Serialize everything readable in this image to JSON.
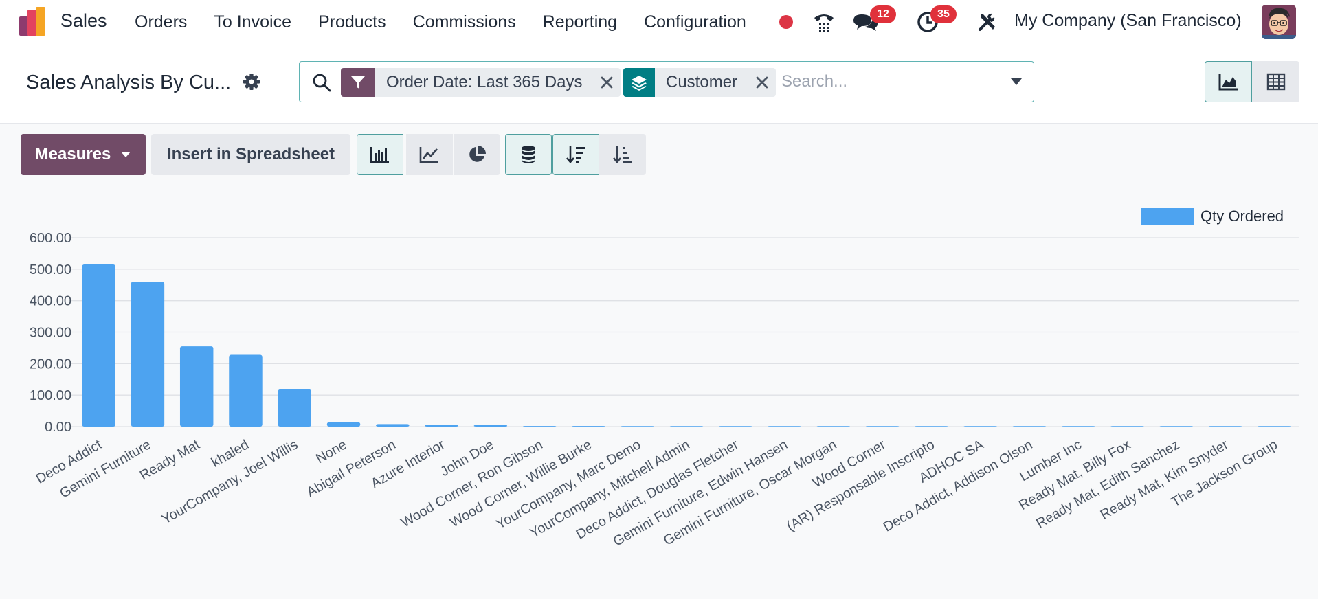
{
  "app": {
    "name": "Sales"
  },
  "menu": [
    "Orders",
    "To Invoice",
    "Products",
    "Commissions",
    "Reporting",
    "Configuration"
  ],
  "systray": {
    "messages_count": "12",
    "activities_count": "35",
    "company": "My Company (San Francisco)"
  },
  "page": {
    "title": "Sales Analysis By Cu..."
  },
  "search": {
    "facets": [
      {
        "label": "Order Date: Last 365 Days",
        "type": "filter"
      },
      {
        "label": "Customer",
        "type": "group-by"
      }
    ],
    "placeholder": "Search..."
  },
  "toolbar": {
    "measures_label": "Measures",
    "insert_label": "Insert in Spreadsheet"
  },
  "colors": {
    "brand": "#714b67",
    "bar": "#4da3f0",
    "accent": "#017e84"
  },
  "chart_data": {
    "type": "bar",
    "title": "",
    "xlabel": "",
    "ylabel": "",
    "legend": {
      "position": "top-right",
      "entries": [
        "Qty Ordered"
      ]
    },
    "grid": true,
    "ylim": [
      0,
      600
    ],
    "y_ticks": [
      "0.00",
      "100.00",
      "200.00",
      "300.00",
      "400.00",
      "500.00",
      "600.00"
    ],
    "categories": [
      "Deco Addict",
      "Gemini Furniture",
      "Ready Mat",
      "khaled",
      "YourCompany, Joel Willis",
      "None",
      "Abigail Peterson",
      "Azure Interior",
      "John Doe",
      "Wood Corner, Ron Gibson",
      "Wood Corner, Willie Burke",
      "YourCompany, Marc Demo",
      "YourCompany, Mitchell Admin",
      "Deco Addict, Douglas Fletcher",
      "Gemini Furniture, Edwin Hansen",
      "Gemini Furniture, Oscar Morgan",
      "Wood Corner",
      "(AR) Responsable Inscripto",
      "ADHOC SA",
      "Deco Addict, Addison Olson",
      "Lumber Inc",
      "Ready Mat, Billy Fox",
      "Ready Mat, Edith Sanchez",
      "Ready Mat, Kim Snyder",
      "The Jackson Group"
    ],
    "series": [
      {
        "name": "Qty Ordered",
        "values": [
          515,
          460,
          255,
          228,
          118,
          14,
          8,
          6,
          5,
          2,
          2,
          1,
          1,
          1,
          1,
          1,
          1,
          1,
          1,
          1,
          1,
          1,
          1,
          1,
          1
        ]
      }
    ]
  }
}
